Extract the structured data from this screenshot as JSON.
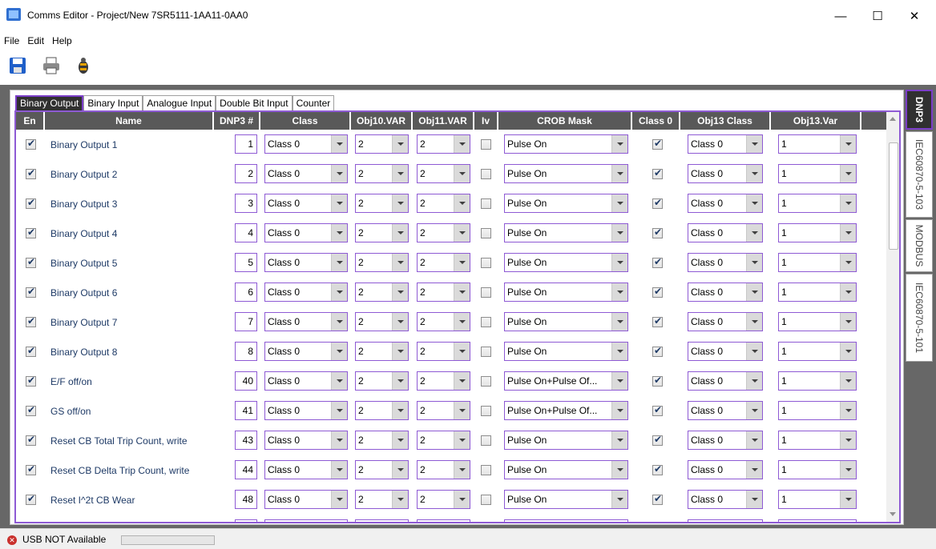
{
  "window": {
    "title": "Comms Editor - Project/New 7SR5111-1AA11-0AA0",
    "minimize_glyph": "—",
    "maximize_glyph": "☐",
    "close_glyph": "✕"
  },
  "menu": [
    "File",
    "Edit",
    "Help"
  ],
  "toolbar": {
    "icons": [
      "save-icon",
      "print-icon",
      "debug-icon"
    ]
  },
  "tabs": [
    {
      "label": "Binary Output",
      "active": true
    },
    {
      "label": "Binary Input",
      "active": false
    },
    {
      "label": "Analogue Input",
      "active": false
    },
    {
      "label": "Double Bit Input",
      "active": false
    },
    {
      "label": "Counter",
      "active": false
    }
  ],
  "side_tabs": [
    {
      "label": "DNP3",
      "active": true
    },
    {
      "label": "IEC60870-5-103",
      "active": false
    },
    {
      "label": "MODBUS",
      "active": false
    },
    {
      "label": "IEC60870-5-101",
      "active": false
    }
  ],
  "columns": [
    "En",
    "Name",
    "DNP3 #",
    "Class",
    "Obj10.VAR",
    "Obj11.VAR",
    "Iv",
    "CROB Mask",
    "Class 0",
    "Obj13 Class",
    "Obj13.Var"
  ],
  "rows": [
    {
      "en": true,
      "name": "Binary Output 1",
      "dnp3": "1",
      "class": "Class 0",
      "obj10": "2",
      "obj11": "2",
      "iv": false,
      "crob": "Pulse On",
      "class0": true,
      "obj13class": "Class 0",
      "obj13var": "1"
    },
    {
      "en": true,
      "name": "Binary Output 2",
      "dnp3": "2",
      "class": "Class 0",
      "obj10": "2",
      "obj11": "2",
      "iv": false,
      "crob": "Pulse On",
      "class0": true,
      "obj13class": "Class 0",
      "obj13var": "1"
    },
    {
      "en": true,
      "name": "Binary Output 3",
      "dnp3": "3",
      "class": "Class 0",
      "obj10": "2",
      "obj11": "2",
      "iv": false,
      "crob": "Pulse On",
      "class0": true,
      "obj13class": "Class 0",
      "obj13var": "1"
    },
    {
      "en": true,
      "name": "Binary Output 4",
      "dnp3": "4",
      "class": "Class 0",
      "obj10": "2",
      "obj11": "2",
      "iv": false,
      "crob": "Pulse On",
      "class0": true,
      "obj13class": "Class 0",
      "obj13var": "1"
    },
    {
      "en": true,
      "name": "Binary Output 5",
      "dnp3": "5",
      "class": "Class 0",
      "obj10": "2",
      "obj11": "2",
      "iv": false,
      "crob": "Pulse On",
      "class0": true,
      "obj13class": "Class 0",
      "obj13var": "1"
    },
    {
      "en": true,
      "name": "Binary Output 6",
      "dnp3": "6",
      "class": "Class 0",
      "obj10": "2",
      "obj11": "2",
      "iv": false,
      "crob": "Pulse On",
      "class0": true,
      "obj13class": "Class 0",
      "obj13var": "1"
    },
    {
      "en": true,
      "name": "Binary Output 7",
      "dnp3": "7",
      "class": "Class 0",
      "obj10": "2",
      "obj11": "2",
      "iv": false,
      "crob": "Pulse On",
      "class0": true,
      "obj13class": "Class 0",
      "obj13var": "1"
    },
    {
      "en": true,
      "name": "Binary Output 8",
      "dnp3": "8",
      "class": "Class 0",
      "obj10": "2",
      "obj11": "2",
      "iv": false,
      "crob": "Pulse On",
      "class0": true,
      "obj13class": "Class 0",
      "obj13var": "1"
    },
    {
      "en": true,
      "name": "E/F off/on",
      "dnp3": "40",
      "class": "Class 0",
      "obj10": "2",
      "obj11": "2",
      "iv": false,
      "crob": "Pulse On+Pulse Of...",
      "class0": true,
      "obj13class": "Class 0",
      "obj13var": "1"
    },
    {
      "en": true,
      "name": "GS off/on",
      "dnp3": "41",
      "class": "Class 0",
      "obj10": "2",
      "obj11": "2",
      "iv": false,
      "crob": "Pulse On+Pulse Of...",
      "class0": true,
      "obj13class": "Class 0",
      "obj13var": "1"
    },
    {
      "en": true,
      "name": "Reset CB Total Trip Count, write",
      "dnp3": "43",
      "class": "Class 0",
      "obj10": "2",
      "obj11": "2",
      "iv": false,
      "crob": "Pulse On",
      "class0": true,
      "obj13class": "Class 0",
      "obj13var": "1"
    },
    {
      "en": true,
      "name": "Reset CB Delta Trip Count, write",
      "dnp3": "44",
      "class": "Class 0",
      "obj10": "2",
      "obj11": "2",
      "iv": false,
      "crob": "Pulse On",
      "class0": true,
      "obj13class": "Class 0",
      "obj13var": "1"
    },
    {
      "en": true,
      "name": "Reset I^2t CB Wear",
      "dnp3": "48",
      "class": "Class 0",
      "obj10": "2",
      "obj11": "2",
      "iv": false,
      "crob": "Pulse On",
      "class0": true,
      "obj13class": "Class 0",
      "obj13var": "1"
    }
  ],
  "status": {
    "text": "USB NOT Available",
    "icon": "error-icon",
    "progress": 0
  },
  "colors": {
    "accent": "#8e5ad4",
    "header_bg": "#595959",
    "name_text": "#1e3a66",
    "workarea": "#676767"
  }
}
